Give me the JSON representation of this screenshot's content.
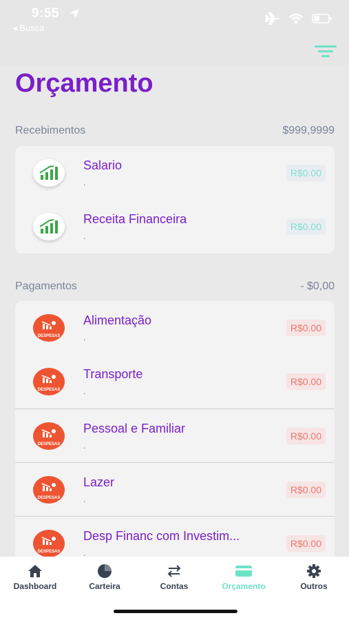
{
  "status": {
    "time": "9:55",
    "back_label": "◂ Busca"
  },
  "page": {
    "title": "Orçamento"
  },
  "recebimentos": {
    "label": "Recebimentos",
    "total": "$999,9999",
    "items": [
      {
        "title": "Salario",
        "subtitle": ".",
        "amount": "R$0.00"
      },
      {
        "title": "Receita Financeira",
        "subtitle": ".",
        "amount": "R$0.00"
      }
    ]
  },
  "pagamentos": {
    "label": "Pagamentos",
    "total": "- $0,00",
    "icon_text": "DESPESAS",
    "items": [
      {
        "title": "Alimentação",
        "subtitle": ".",
        "amount": "R$0.00"
      },
      {
        "title": "Transporte",
        "subtitle": ".",
        "amount": "R$0.00"
      },
      {
        "title": "Pessoal e Familiar",
        "subtitle": ".",
        "amount": "R$0.00"
      },
      {
        "title": "Lazer",
        "subtitle": ".",
        "amount": "R$0.00"
      },
      {
        "title": "Desp Financ com Investim...",
        "subtitle": ".",
        "amount": "R$0.00"
      }
    ]
  },
  "tabs": [
    {
      "label": "Dashboard",
      "icon": "home-icon"
    },
    {
      "label": "Carteira",
      "icon": "pie-chart-icon"
    },
    {
      "label": "Contas",
      "icon": "transfer-icon"
    },
    {
      "label": "Orçamento",
      "icon": "budget-card-icon",
      "active": true
    },
    {
      "label": "Outros",
      "icon": "gear-icon"
    }
  ],
  "colors": {
    "accent_purple": "#7a1fc8",
    "accent_teal": "#6ee2c6",
    "expense_red": "#ee5432",
    "income_green": "#3aa845"
  }
}
